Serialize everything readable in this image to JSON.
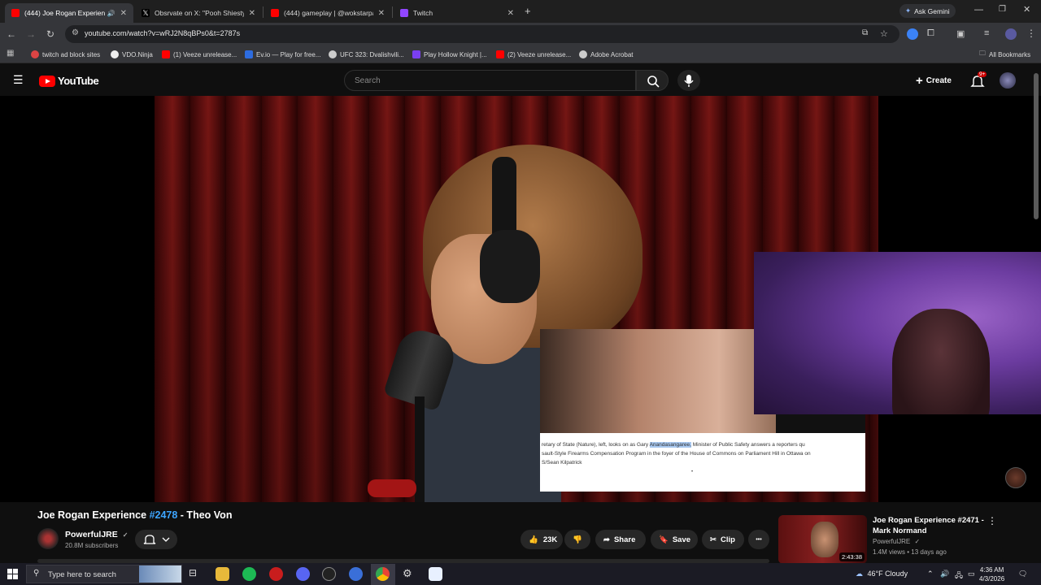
{
  "browser": {
    "tabs": [
      {
        "title": "(444) Joe Rogan Experienc",
        "active": true,
        "favicon": "youtube"
      },
      {
        "title": "Obsrvate on X: \"Pooh Shiesty n",
        "active": false,
        "favicon": "x"
      },
      {
        "title": "(444) gameplay | @wokstarpaj",
        "active": false,
        "favicon": "youtube"
      },
      {
        "title": "Twitch",
        "active": false,
        "favicon": "twitch"
      }
    ],
    "new_tab": "+",
    "ask_gemini": "Ask Gemini",
    "url": "youtube.com/watch?v=wRJ2N8qBPs0&t=2787s",
    "bookmarks": [
      "twitch ad block sites",
      "VDO.Ninja",
      "(1) Veeze unrelease...",
      "Ev.io — Play for free...",
      "UFC 323: Dvalishvili...",
      "Play Hollow Knight |...",
      "(2) Veeze unrelease...",
      "Adobe Acrobat"
    ],
    "all_bookmarks": "All Bookmarks"
  },
  "youtube": {
    "logo_text": "YouTube",
    "search_placeholder": "Search",
    "create_label": "Create",
    "notif_badge": "9+"
  },
  "overlay": {
    "caption_pre": "retary of State (Nature), left, looks on as Gary ",
    "caption_hl": "Anandasangaree,",
    "caption_post": " Minister of Public Safety answers a reporters qu",
    "caption_line2": "sault-Style Firearms Compensation Program in the foyer of the House of Commons on Parliament Hill in Ottawa on",
    "caption_line3": "S/Sean Kilpatrick",
    "caption_dot": "•"
  },
  "video": {
    "title_prefix": "Joe Rogan Experience ",
    "title_tag": "#2478",
    "title_suffix": " - Theo Von",
    "channel": "PowerfulJRE",
    "verified": "✓",
    "subscribers": "20.8M subscribers",
    "likes": "23K",
    "share": "Share",
    "save": "Save",
    "clip": "Clip",
    "more": "•••"
  },
  "recommended": {
    "title": "Joe Rogan Experience #2471 - Mark Normand",
    "channel": "PowerfulJRE",
    "meta": "1.4M views • 13 days ago",
    "duration": "2:43:38"
  },
  "taskbar": {
    "search_placeholder": "Type here to search",
    "weather": "46°F  Cloudy",
    "time": "4:36 AM",
    "date": "4/3/2026"
  },
  "colors": {
    "yt_red": "#ff0000",
    "link_blue": "#3ea6ff",
    "tab_active": "#35363a"
  }
}
